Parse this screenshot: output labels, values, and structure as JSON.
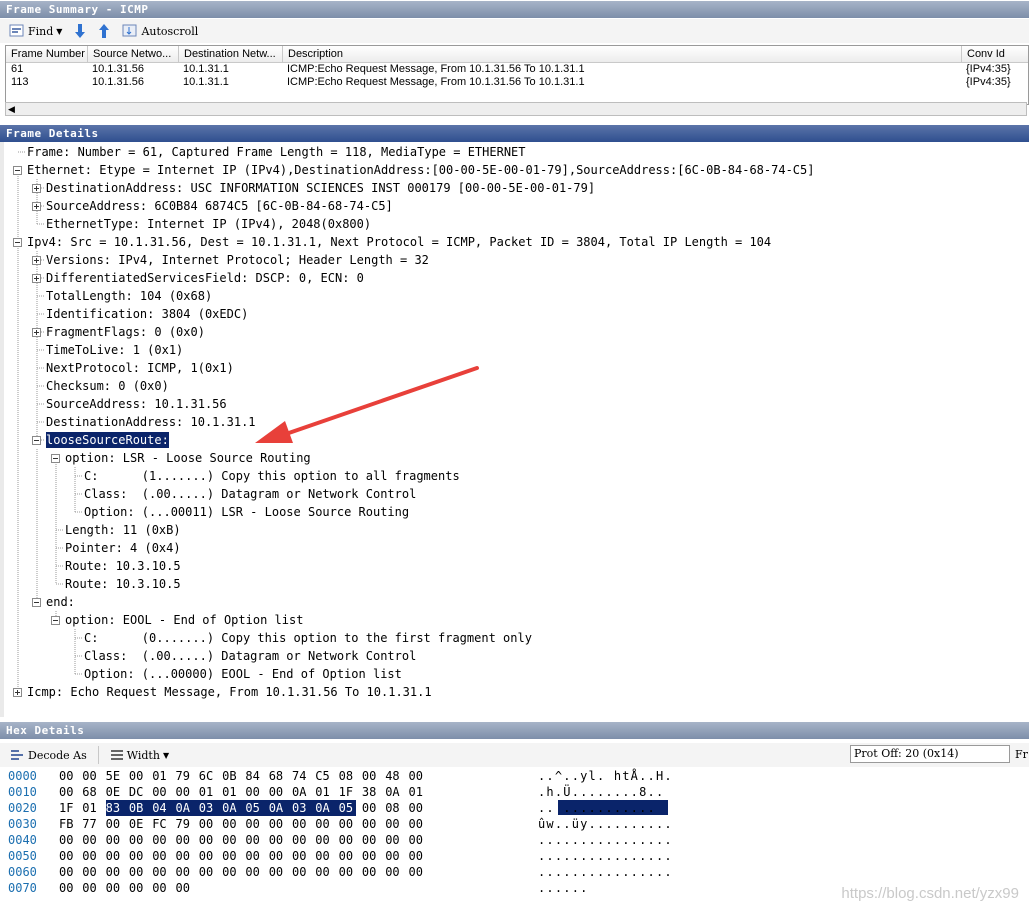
{
  "frame_summary": {
    "title": "Frame Summary - ICMP",
    "toolbar": {
      "find_label": "Find",
      "autoscroll_label": "Autoscroll"
    },
    "columns": [
      "Frame Number",
      "Source Netwo...",
      "Destination Netw...",
      "Description",
      "Conv Id"
    ],
    "rows": [
      [
        "61",
        "10.1.31.56",
        "10.1.31.1",
        "ICMP:Echo Request Message, From 10.1.31.56 To 10.1.31.1",
        "{IPv4:35}"
      ],
      [
        "113",
        "10.1.31.56",
        "10.1.31.1",
        "ICMP:Echo Request Message, From 10.1.31.56 To 10.1.31.1",
        "{IPv4:35}"
      ]
    ]
  },
  "frame_details": {
    "title": "Frame Details",
    "nodes": [
      "Frame: Number = 61, Captured Frame Length = 118, MediaType = ETHERNET",
      "Ethernet: Etype = Internet IP (IPv4),DestinationAddress:[00-00-5E-00-01-79],SourceAddress:[6C-0B-84-68-74-C5]",
      "DestinationAddress: USC INFORMATION SCIENCES INST 000179 [00-00-5E-00-01-79]",
      "SourceAddress: 6C0B84 6874C5 [6C-0B-84-68-74-C5]",
      "EthernetType: Internet IP (IPv4), 2048(0x800)",
      "Ipv4: Src = 10.1.31.56, Dest = 10.1.31.1, Next Protocol = ICMP, Packet ID = 3804, Total IP Length = 104",
      "Versions: IPv4, Internet Protocol; Header Length = 32",
      "DifferentiatedServicesField: DSCP: 0, ECN: 0",
      "TotalLength: 104 (0x68)",
      "Identification: 3804 (0xEDC)",
      "FragmentFlags: 0 (0x0)",
      "TimeToLive: 1 (0x1)",
      "NextProtocol: ICMP, 1(0x1)",
      "Checksum: 0 (0x0)",
      "SourceAddress: 10.1.31.56",
      "DestinationAddress: 10.1.31.1",
      "looseSourceRoute:",
      "option: LSR - Loose Source Routing",
      "C:      (1.......) Copy this option to all fragments",
      "Class:  (.00.....) Datagram or Network Control",
      "Option: (...00011) LSR - Loose Source Routing",
      "Length: 11 (0xB)",
      "Pointer: 4 (0x4)",
      "Route: 10.3.10.5",
      "Route: 10.3.10.5",
      "end:",
      "option: EOOL - End of Option list",
      "C:      (0.......) Copy this option to the first fragment only",
      "Class:  (.00.....) Datagram or Network Control",
      "Option: (...00000) EOOL - End of Option list",
      "Icmp: Echo Request Message, From 10.1.31.56 To 10.1.31.1"
    ]
  },
  "hex_details": {
    "title": "Hex Details",
    "toolbar": {
      "decode_as_label": "Decode As",
      "width_label": "Width",
      "prot_off": "Prot Off: 20 (0x14)",
      "fr_label": "Fr"
    },
    "rows": [
      {
        "offset": "0000",
        "bytes": [
          "00",
          "00",
          "5E",
          "00",
          "01",
          "79",
          "6C",
          "0B",
          "84",
          "68",
          "74",
          "C5",
          "08",
          "00",
          "48",
          "00"
        ],
        "ascii": "..^..yl. htÅ..H."
      },
      {
        "offset": "0010",
        "bytes": [
          "00",
          "68",
          "0E",
          "DC",
          "00",
          "00",
          "01",
          "01",
          "00",
          "00",
          "0A",
          "01",
          "1F",
          "38",
          "0A",
          "01"
        ],
        "ascii": ".h.Ü........8.."
      },
      {
        "offset": "0020",
        "bytes": [
          "1F",
          "01",
          "83",
          "0B",
          "04",
          "0A",
          "03",
          "0A",
          "05",
          "0A",
          "03",
          "0A",
          "05",
          "00",
          "08",
          "00"
        ],
        "ascii": ".. ..........."
      },
      {
        "offset": "0030",
        "bytes": [
          "FB",
          "77",
          "00",
          "0E",
          "FC",
          "79",
          "00",
          "00",
          "00",
          "00",
          "00",
          "00",
          "00",
          "00",
          "00",
          "00"
        ],
        "ascii": "ûw..üy.........."
      },
      {
        "offset": "0040",
        "bytes": [
          "00",
          "00",
          "00",
          "00",
          "00",
          "00",
          "00",
          "00",
          "00",
          "00",
          "00",
          "00",
          "00",
          "00",
          "00",
          "00"
        ],
        "ascii": "................"
      },
      {
        "offset": "0050",
        "bytes": [
          "00",
          "00",
          "00",
          "00",
          "00",
          "00",
          "00",
          "00",
          "00",
          "00",
          "00",
          "00",
          "00",
          "00",
          "00",
          "00"
        ],
        "ascii": "................"
      },
      {
        "offset": "0060",
        "bytes": [
          "00",
          "00",
          "00",
          "00",
          "00",
          "00",
          "00",
          "00",
          "00",
          "00",
          "00",
          "00",
          "00",
          "00",
          "00",
          "00"
        ],
        "ascii": "................"
      },
      {
        "offset": "0070",
        "bytes": [
          "00",
          "00",
          "00",
          "00",
          "00",
          "00"
        ],
        "ascii": "......"
      }
    ]
  },
  "watermark": "https://blog.csdn.net/yzx99",
  "colors": {
    "selection": "#0a246a",
    "offset": "#1c6fb0",
    "arrow": "#e8403a"
  }
}
